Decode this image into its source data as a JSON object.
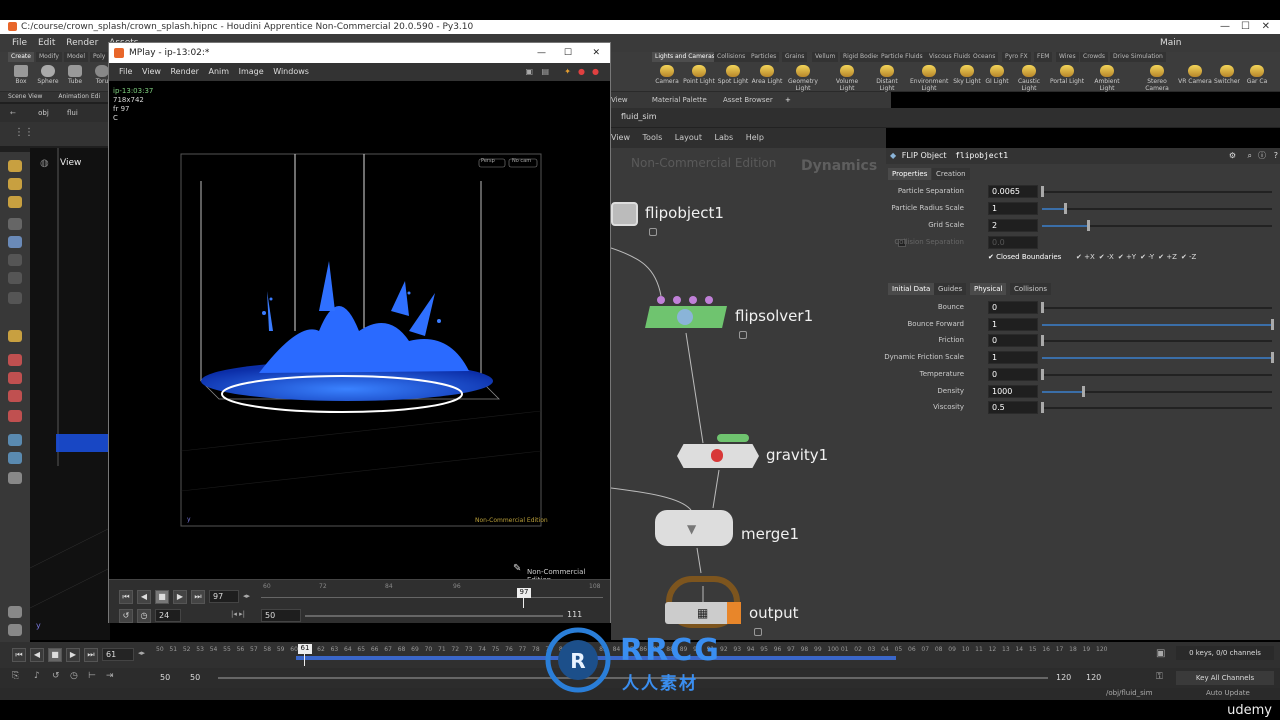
{
  "houdini": {
    "title": "C:/course/crown_splash/crown_splash.hipnc - Houdini Apprentice Non-Commercial 20.0.590 - Py3.10",
    "menu": [
      "File",
      "Edit",
      "Render",
      "Assets"
    ],
    "shelf_tabs_left": [
      "Create",
      "Modify",
      "Model",
      "Poly"
    ],
    "shelf_tools_left": [
      "Box",
      "Sphere",
      "Tube",
      "Toru"
    ],
    "shelf_tabs_right": [
      "Lights and Cameras",
      "Collisions",
      "Particles",
      "Grains",
      "Vellum",
      "Rigid Bodies",
      "Particle Fluids",
      "Viscous Fluids",
      "Oceans",
      "Pyro FX",
      "FEM",
      "Wires",
      "Crowds",
      "Drive Simulation"
    ],
    "shelf_tools_right": [
      "Camera",
      "Point Light",
      "Spot Light",
      "Area Light",
      "Geometry Light",
      "Volume Light",
      "Distant Light",
      "Environment Light",
      "Sky Light",
      "GI Light",
      "Caustic Light",
      "Portal Light",
      "Ambient Light",
      "Stereo Camera",
      "VR Camera",
      "Switcher",
      "Gar Ca"
    ],
    "desktop": "Main"
  },
  "scene_view": {
    "tabs": [
      "Scene View",
      "Animation Edi"
    ],
    "path": "obj",
    "path2": "flui",
    "viewport_label": "View"
  },
  "mplay": {
    "title": "MPlay - ip-13:02:*",
    "menu": [
      "File",
      "View",
      "Render",
      "Anim",
      "Image",
      "Windows"
    ],
    "info": {
      "name": "ip-13:03:37",
      "res": "718x742",
      "frame": "fr 97",
      "channel": "C"
    },
    "overlay_text": "Non-Commercial Edition",
    "frame_field": "97",
    "fps_field": "24",
    "range_start": "50",
    "range_end": "111",
    "ruler_ticks": [
      "60",
      "72",
      "84",
      "96",
      "108"
    ],
    "current_marker": "97",
    "corner_btns": [
      "Persp",
      "No cam"
    ]
  },
  "network": {
    "tabs": [
      "View",
      "Material Palette",
      "Asset Browser"
    ],
    "path": "fluid_sim",
    "menu": [
      "View",
      "Tools",
      "Layout",
      "Labs",
      "Help"
    ],
    "watermark": "Non-Commercial Edition",
    "context": "Dynamics",
    "nodes": [
      {
        "label": "flipobject1"
      },
      {
        "label": "flipsolver1"
      },
      {
        "label": "gravity1"
      },
      {
        "label": "merge1"
      },
      {
        "label": "output"
      }
    ],
    "footer_watermark": "Non-Commercial Edition"
  },
  "params": {
    "node_type": "FLIP Object",
    "node_name": "flipobject1",
    "tabs_top": [
      "Properties",
      "Creation"
    ],
    "rows_top": [
      {
        "label": "Particle Separation",
        "value": "0.0065",
        "fill": 0.0
      },
      {
        "label": "Particle Radius Scale",
        "value": "1",
        "fill": 0.1
      },
      {
        "label": "Grid Scale",
        "value": "2",
        "fill": 0.2
      },
      {
        "label": "Collision Separation",
        "value": "0.0",
        "fill": 0.0
      }
    ],
    "closed_boundaries_label": "Closed Boundaries",
    "axes": [
      "+X",
      "-X",
      "+Y",
      "-Y",
      "+Z",
      "-Z"
    ],
    "tabs_mid": [
      "Initial Data",
      "Guides",
      "Physical",
      "Collisions"
    ],
    "rows_phys": [
      {
        "label": "Bounce",
        "value": "0",
        "fill": 0.0
      },
      {
        "label": "Bounce Forward",
        "value": "1",
        "fill": 1.0
      },
      {
        "label": "Friction",
        "value": "0",
        "fill": 0.0
      },
      {
        "label": "Dynamic Friction Scale",
        "value": "1",
        "fill": 1.0
      },
      {
        "label": "Temperature",
        "value": "0",
        "fill": 0.0
      },
      {
        "label": "Density",
        "value": "1000",
        "fill": 0.18
      },
      {
        "label": "Viscosity",
        "value": "0.5",
        "fill": 0.0
      }
    ]
  },
  "timeline": {
    "frame": "61",
    "marker": "61",
    "start": "50",
    "start2": "50",
    "end": "120",
    "end2": "120",
    "keys": "0 keys, 0/0 channels",
    "key_all": "Key All Channels",
    "path": "/obj/fluid_sim",
    "auto_update": "Auto Update",
    "ticks": [
      "50",
      "51",
      "52",
      "53",
      "54",
      "55",
      "56",
      "57",
      "58",
      "59",
      "60",
      "61",
      "62",
      "63",
      "64",
      "65",
      "66",
      "67",
      "68",
      "69",
      "70",
      "71",
      "72",
      "73",
      "74",
      "75",
      "76",
      "77",
      "78",
      "79",
      "80",
      "81",
      "82",
      "83",
      "84",
      "85",
      "86",
      "87",
      "88",
      "89",
      "90",
      "91",
      "92",
      "93",
      "94",
      "95",
      "96",
      "97",
      "98",
      "99",
      "100",
      "01",
      "02",
      "03",
      "04",
      "05",
      "06",
      "07",
      "08",
      "09",
      "10",
      "11",
      "12",
      "13",
      "14",
      "15",
      "16",
      "17",
      "18",
      "19",
      "120"
    ]
  },
  "watermark": {
    "brand": "RRCG",
    "sub": "人人素材"
  },
  "udemy": "udemy"
}
